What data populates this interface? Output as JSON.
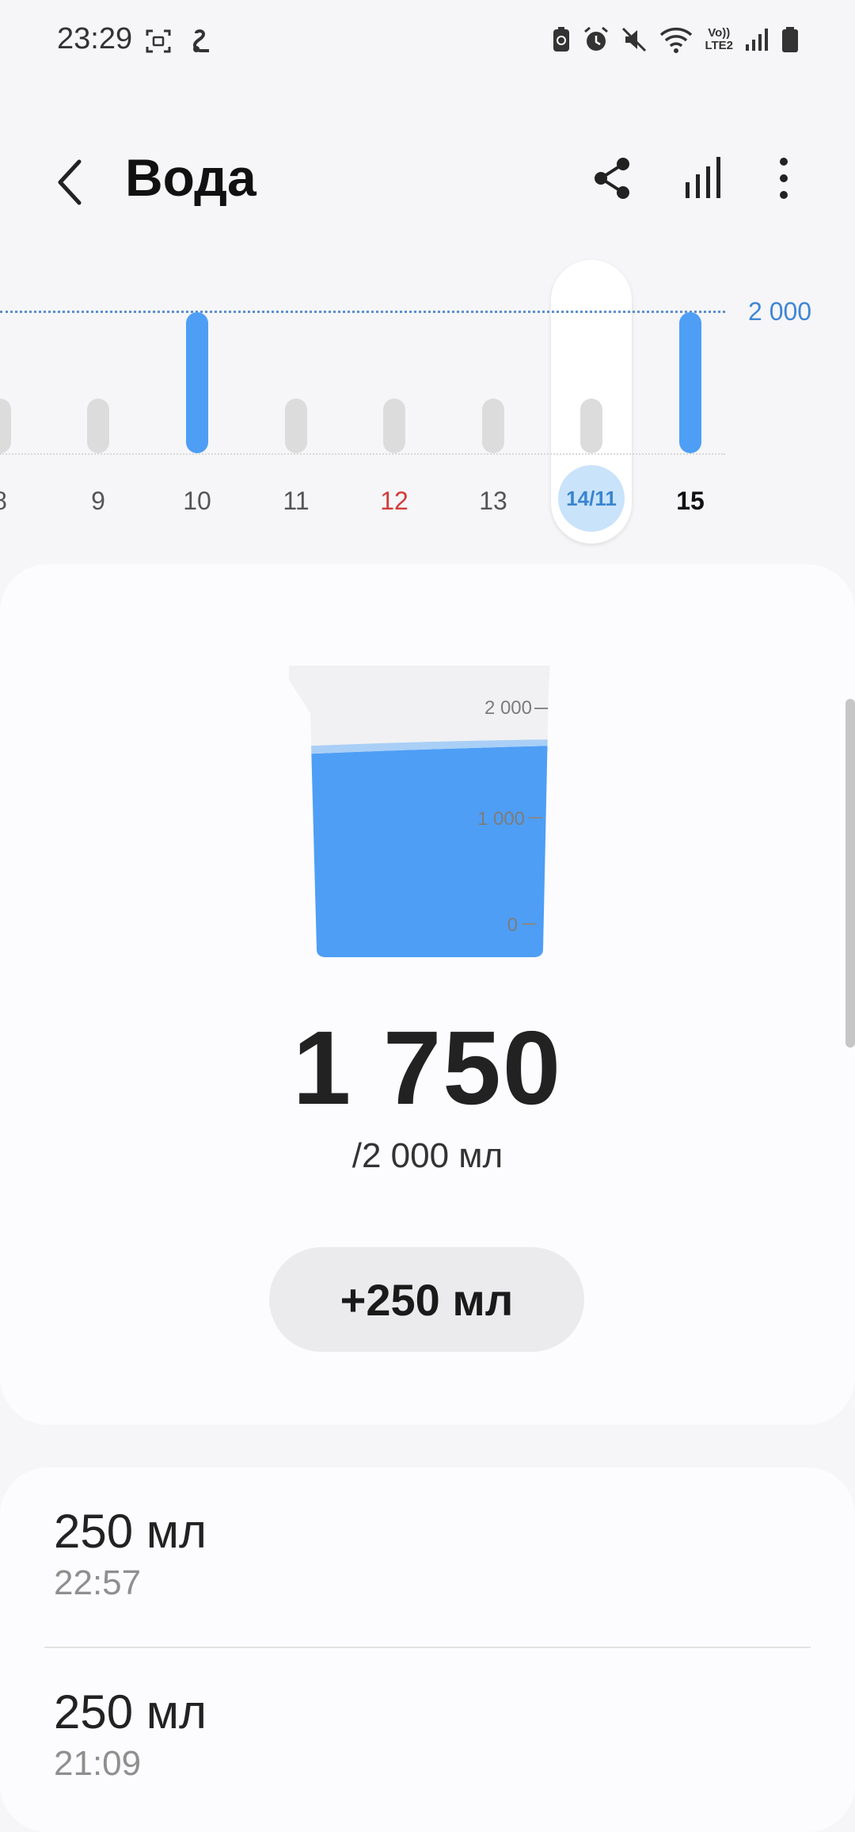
{
  "status_bar": {
    "time": "23:29",
    "volte_top": "Vo))",
    "volte_bottom": "LTE2",
    "icons": [
      "screen-record-icon",
      "notification-icon",
      "battery-saver-icon",
      "alarm-icon",
      "mute-icon",
      "wifi-icon",
      "volte-icon",
      "signal-icon",
      "battery-icon"
    ]
  },
  "header": {
    "title": "Вода",
    "actions": [
      "back-icon",
      "share-icon",
      "chart-icon",
      "more-icon"
    ]
  },
  "weekly_chart": {
    "goal_label": "2 000",
    "goal_value": 2000,
    "selected_date": "14/11",
    "colors": {
      "filled": "#4e9ef5",
      "empty": "#dcdcdc",
      "goal": "#3f86d6",
      "weekend": "#d23b3b"
    }
  },
  "chart_data": {
    "type": "bar",
    "categories": [
      "8",
      "9",
      "10",
      "11",
      "12",
      "13",
      "14/11",
      "15"
    ],
    "values": [
      1000,
      1000,
      2000,
      1000,
      1000,
      1000,
      1000,
      2000
    ],
    "filled": [
      false,
      false,
      true,
      false,
      false,
      false,
      false,
      true
    ],
    "goal": 2000,
    "ylim": [
      0,
      2000
    ]
  },
  "cup": {
    "scale_labels": [
      "2 000",
      "1 000",
      "0"
    ],
    "fill_fraction": 0.875
  },
  "intake": {
    "value": "1 750",
    "target": "/2 000 мл",
    "add_button": "+250 мл"
  },
  "log": {
    "entries": [
      {
        "amount": "250 мл",
        "time": "22:57"
      },
      {
        "amount": "250 мл",
        "time": "21:09"
      }
    ]
  }
}
